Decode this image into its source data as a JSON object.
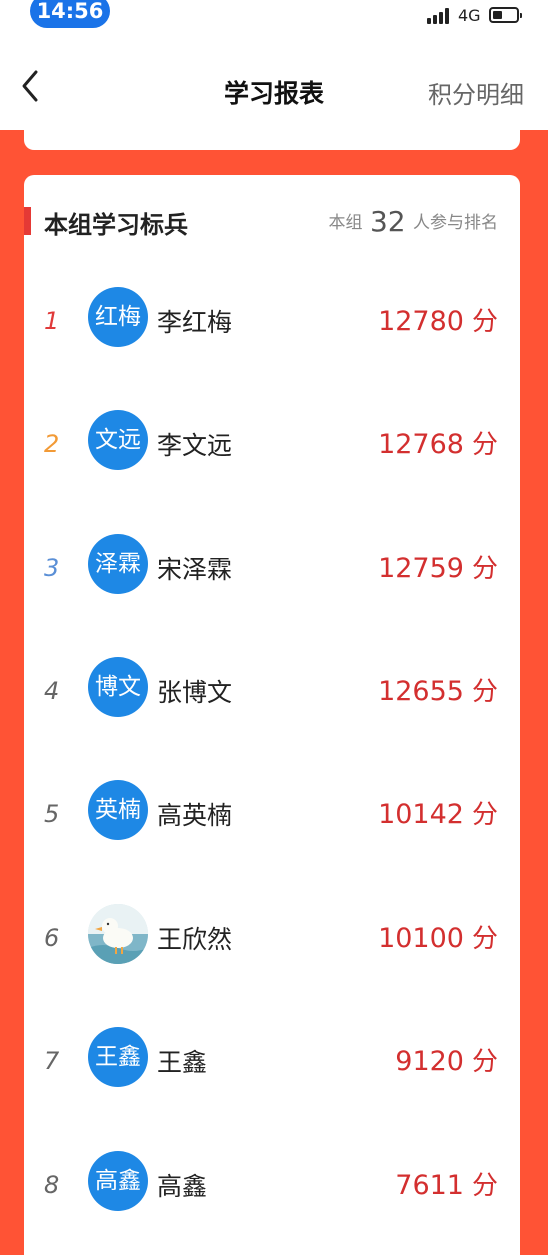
{
  "status_bar": {
    "time": "14:56",
    "network": "4G"
  },
  "header": {
    "title": "学习报表",
    "right_link": "积分明细"
  },
  "leaderboard": {
    "title": "本组学习标兵",
    "participants_prefix": "本组",
    "participants_count": "32",
    "participants_suffix": "人参与排名",
    "score_unit": "分",
    "members": [
      {
        "rank": "1",
        "avatar_text": "红梅",
        "name": "李红梅",
        "score": "12780"
      },
      {
        "rank": "2",
        "avatar_text": "文远",
        "name": "李文远",
        "score": "12768"
      },
      {
        "rank": "3",
        "avatar_text": "泽霖",
        "name": "宋泽霖",
        "score": "12759"
      },
      {
        "rank": "4",
        "avatar_text": "博文",
        "name": "张博文",
        "score": "12655"
      },
      {
        "rank": "5",
        "avatar_text": "英楠",
        "name": "高英楠",
        "score": "10142"
      },
      {
        "rank": "6",
        "avatar_text": "",
        "name": "王欣然",
        "score": "10100"
      },
      {
        "rank": "7",
        "avatar_text": "王鑫",
        "name": "王鑫",
        "score": "9120"
      },
      {
        "rank": "8",
        "avatar_text": "高鑫",
        "name": "高鑫",
        "score": "7611"
      }
    ]
  },
  "colors": {
    "page_background": "#ff5335",
    "avatar_blue": "#1e88e5",
    "score_red": "#d32f2f",
    "rank_1": "#e03a3a",
    "rank_2": "#f29a36",
    "rank_3": "#5a8fd6"
  },
  "icons": {
    "back": "chevron-left-icon",
    "signal": "signal-bars-icon",
    "battery": "battery-icon",
    "photo_avatar": "duck-photo-avatar"
  }
}
